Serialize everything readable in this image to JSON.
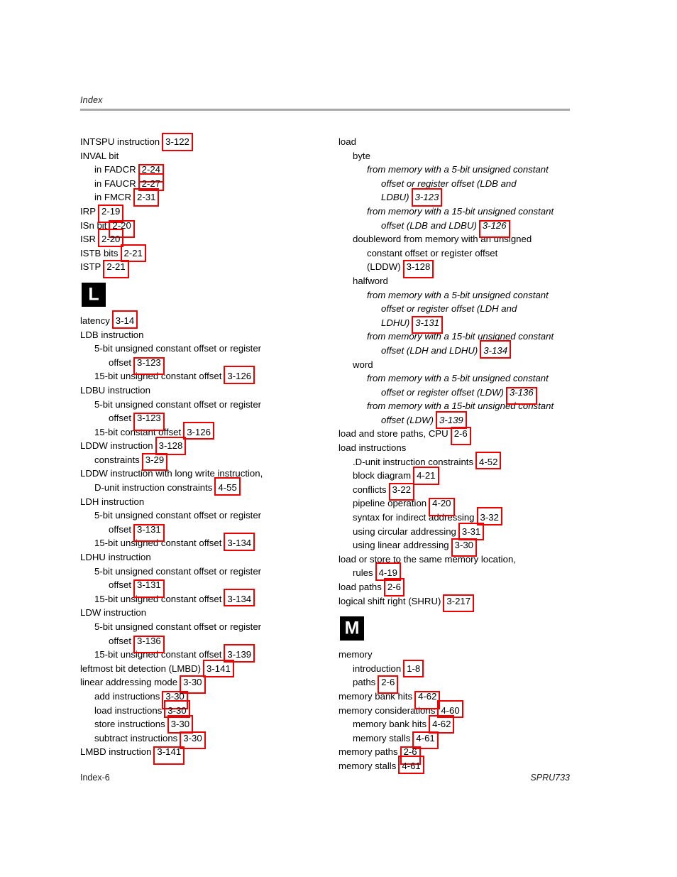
{
  "header": {
    "title": "Index"
  },
  "footer": {
    "page_label": "Index-6",
    "doc_number": "SPRU733"
  },
  "colors": {
    "annotation_box": "#ee0000",
    "header_rule": "#a9a9a9",
    "letter_block_bg": "#000000",
    "letter_block_fg": "#ffffff"
  },
  "columns": {
    "left": [
      {
        "kind": "entry",
        "level": 0,
        "text": "INTSPU instruction",
        "ref": "3-122"
      },
      {
        "kind": "entry",
        "level": 0,
        "text": "INVAL bit"
      },
      {
        "kind": "entry",
        "level": 1,
        "text": "in FADCR",
        "ref": "2-24"
      },
      {
        "kind": "entry",
        "level": 1,
        "text": "in FAUCR",
        "ref": "2-27"
      },
      {
        "kind": "entry",
        "level": 1,
        "text": "in FMCR",
        "ref": "2-31"
      },
      {
        "kind": "entry",
        "level": 0,
        "text": "IRP",
        "ref": "2-19"
      },
      {
        "kind": "entry",
        "level": 0,
        "text": "ISn bit",
        "ref": "2-20"
      },
      {
        "kind": "entry",
        "level": 0,
        "text": "ISR",
        "ref": "2-20"
      },
      {
        "kind": "entry",
        "level": 0,
        "text": "ISTB bits",
        "ref": "2-21"
      },
      {
        "kind": "entry",
        "level": 0,
        "text": "ISTP",
        "ref": "2-21"
      },
      {
        "kind": "letter",
        "letter": "L"
      },
      {
        "kind": "entry",
        "level": 0,
        "text": "latency",
        "ref": "3-14"
      },
      {
        "kind": "entry",
        "level": 0,
        "text": "LDB instruction"
      },
      {
        "kind": "entry",
        "level": 1,
        "text": "5-bit unsigned constant offset or register"
      },
      {
        "kind": "entry",
        "level": 2,
        "text": "offset",
        "ref": "3-123"
      },
      {
        "kind": "entry",
        "level": 1,
        "text": "15-bit unsigned constant offset",
        "ref": "3-126"
      },
      {
        "kind": "entry",
        "level": 0,
        "text": "LDBU instruction"
      },
      {
        "kind": "entry",
        "level": 1,
        "text": "5-bit unsigned constant offset or register"
      },
      {
        "kind": "entry",
        "level": 2,
        "text": "offset",
        "ref": "3-123"
      },
      {
        "kind": "entry",
        "level": 1,
        "text": "15-bit constant offset",
        "ref": "3-126"
      },
      {
        "kind": "entry",
        "level": 0,
        "text": "LDDW instruction",
        "ref": "3-128"
      },
      {
        "kind": "entry",
        "level": 1,
        "text": "constraints",
        "ref": "3-29"
      },
      {
        "kind": "entry",
        "level": 0,
        "text": "LDDW instruction with long write instruction,"
      },
      {
        "kind": "entry",
        "level": 1,
        "text": "D-unit instruction constraints",
        "ref": "4-55"
      },
      {
        "kind": "entry",
        "level": 0,
        "text": "LDH instruction"
      },
      {
        "kind": "entry",
        "level": 1,
        "text": "5-bit unsigned constant offset or register"
      },
      {
        "kind": "entry",
        "level": 2,
        "text": "offset",
        "ref": "3-131"
      },
      {
        "kind": "entry",
        "level": 1,
        "text": "15-bit unsigned constant offset",
        "ref": "3-134"
      },
      {
        "kind": "entry",
        "level": 0,
        "text": "LDHU instruction"
      },
      {
        "kind": "entry",
        "level": 1,
        "text": "5-bit unsigned constant offset or register"
      },
      {
        "kind": "entry",
        "level": 2,
        "text": "offset",
        "ref": "3-131"
      },
      {
        "kind": "entry",
        "level": 1,
        "text": "15-bit unsigned constant offset",
        "ref": "3-134"
      },
      {
        "kind": "entry",
        "level": 0,
        "text": "LDW instruction"
      },
      {
        "kind": "entry",
        "level": 1,
        "text": "5-bit unsigned constant offset or register"
      },
      {
        "kind": "entry",
        "level": 2,
        "text": "offset",
        "ref": "3-136"
      },
      {
        "kind": "entry",
        "level": 1,
        "text": "15-bit unsigned constant offset",
        "ref": "3-139"
      },
      {
        "kind": "entry",
        "level": 0,
        "text": "leftmost bit detection (LMBD)",
        "ref": "3-141"
      },
      {
        "kind": "entry",
        "level": 0,
        "text": "linear addressing mode",
        "ref": "3-30"
      },
      {
        "kind": "entry",
        "level": 1,
        "text": "add instructions",
        "ref": "3-30"
      },
      {
        "kind": "entry",
        "level": 1,
        "text": "load instructions",
        "ref": "3-30"
      },
      {
        "kind": "entry",
        "level": 1,
        "text": "store instructions",
        "ref": "3-30"
      },
      {
        "kind": "entry",
        "level": 1,
        "text": "subtract instructions",
        "ref": "3-30"
      },
      {
        "kind": "entry",
        "level": 0,
        "text": "LMBD instruction",
        "ref": "3-141"
      }
    ],
    "right": [
      {
        "kind": "entry",
        "level": 0,
        "text": "load"
      },
      {
        "kind": "entry",
        "level": 1,
        "text": "byte"
      },
      {
        "kind": "entry",
        "level": 2,
        "italic": true,
        "text": "from memory with a 5-bit unsigned constant"
      },
      {
        "kind": "entry",
        "level": 3,
        "italic": true,
        "text": "offset or register offset (LDB and"
      },
      {
        "kind": "entry",
        "level": 3,
        "italic": true,
        "text": "LDBU)",
        "ref": "3-123",
        "ref_italic": true
      },
      {
        "kind": "entry",
        "level": 2,
        "italic": true,
        "text": "from memory with a 15-bit unsigned constant"
      },
      {
        "kind": "entry",
        "level": 3,
        "italic": true,
        "text": "offset (LDB and LDBU)",
        "ref": "3-126",
        "ref_italic": true
      },
      {
        "kind": "entry",
        "level": 1,
        "text": "doubleword from memory with an unsigned"
      },
      {
        "kind": "entry",
        "level": 2,
        "text": "constant offset or register offset"
      },
      {
        "kind": "entry",
        "level": 2,
        "text": "(LDDW)",
        "ref": "3-128"
      },
      {
        "kind": "entry",
        "level": 1,
        "text": "halfword"
      },
      {
        "kind": "entry",
        "level": 2,
        "italic": true,
        "text": "from memory with a 5-bit unsigned constant"
      },
      {
        "kind": "entry",
        "level": 3,
        "italic": true,
        "text": "offset or register offset (LDH and"
      },
      {
        "kind": "entry",
        "level": 3,
        "italic": true,
        "text": "LDHU)",
        "ref": "3-131",
        "ref_italic": true
      },
      {
        "kind": "entry",
        "level": 2,
        "italic": true,
        "text": "from memory with a 15-bit unsigned constant"
      },
      {
        "kind": "entry",
        "level": 3,
        "italic": true,
        "text": "offset (LDH and LDHU)",
        "ref": "3-134",
        "ref_italic": true
      },
      {
        "kind": "entry",
        "level": 1,
        "text": "word"
      },
      {
        "kind": "entry",
        "level": 2,
        "italic": true,
        "text": "from memory with a 5-bit unsigned constant"
      },
      {
        "kind": "entry",
        "level": 3,
        "italic": true,
        "text": "offset or register offset (LDW)",
        "ref": "3-136",
        "ref_italic": true
      },
      {
        "kind": "entry",
        "level": 2,
        "italic": true,
        "text": "from memory with a 15-bit unsigned constant"
      },
      {
        "kind": "entry",
        "level": 3,
        "italic": true,
        "text": "offset (LDW)",
        "ref": "3-139",
        "ref_italic": true
      },
      {
        "kind": "entry",
        "level": 0,
        "text": "load and store paths, CPU",
        "ref": "2-6"
      },
      {
        "kind": "entry",
        "level": 0,
        "text": "load instructions"
      },
      {
        "kind": "entry",
        "level": 1,
        "text": ".D-unit instruction constraints",
        "ref": "4-52"
      },
      {
        "kind": "entry",
        "level": 1,
        "text": "block diagram",
        "ref": "4-21"
      },
      {
        "kind": "entry",
        "level": 1,
        "text": "conflicts",
        "ref": "3-22"
      },
      {
        "kind": "entry",
        "level": 1,
        "text": "pipeline operation",
        "ref": "4-20"
      },
      {
        "kind": "entry",
        "level": 1,
        "text": "syntax for indirect addressing",
        "ref": "3-32"
      },
      {
        "kind": "entry",
        "level": 1,
        "text": "using circular addressing",
        "ref": "3-31"
      },
      {
        "kind": "entry",
        "level": 1,
        "text": "using linear addressing",
        "ref": "3-30"
      },
      {
        "kind": "entry",
        "level": 0,
        "text": "load or store to the same memory location,"
      },
      {
        "kind": "entry",
        "level": 1,
        "text": "rules",
        "ref": "4-19"
      },
      {
        "kind": "entry",
        "level": 0,
        "text": "load paths",
        "ref": "2-6"
      },
      {
        "kind": "entry",
        "level": 0,
        "text": "logical shift right (SHRU)",
        "ref": "3-217"
      },
      {
        "kind": "letter",
        "letter": "M"
      },
      {
        "kind": "entry",
        "level": 0,
        "text": "memory"
      },
      {
        "kind": "entry",
        "level": 1,
        "text": "introduction",
        "ref": "1-8"
      },
      {
        "kind": "entry",
        "level": 1,
        "text": "paths",
        "ref": "2-6"
      },
      {
        "kind": "entry",
        "level": 0,
        "text": "memory bank hits",
        "ref": "4-62"
      },
      {
        "kind": "entry",
        "level": 0,
        "text": "memory considerations",
        "ref": "4-60"
      },
      {
        "kind": "entry",
        "level": 1,
        "text": "memory bank hits",
        "ref": "4-62"
      },
      {
        "kind": "entry",
        "level": 1,
        "text": "memory stalls",
        "ref": "4-61"
      },
      {
        "kind": "entry",
        "level": 0,
        "text": "memory paths",
        "ref": "2-6"
      },
      {
        "kind": "entry",
        "level": 0,
        "text": "memory stalls",
        "ref": "4-61"
      }
    ]
  }
}
